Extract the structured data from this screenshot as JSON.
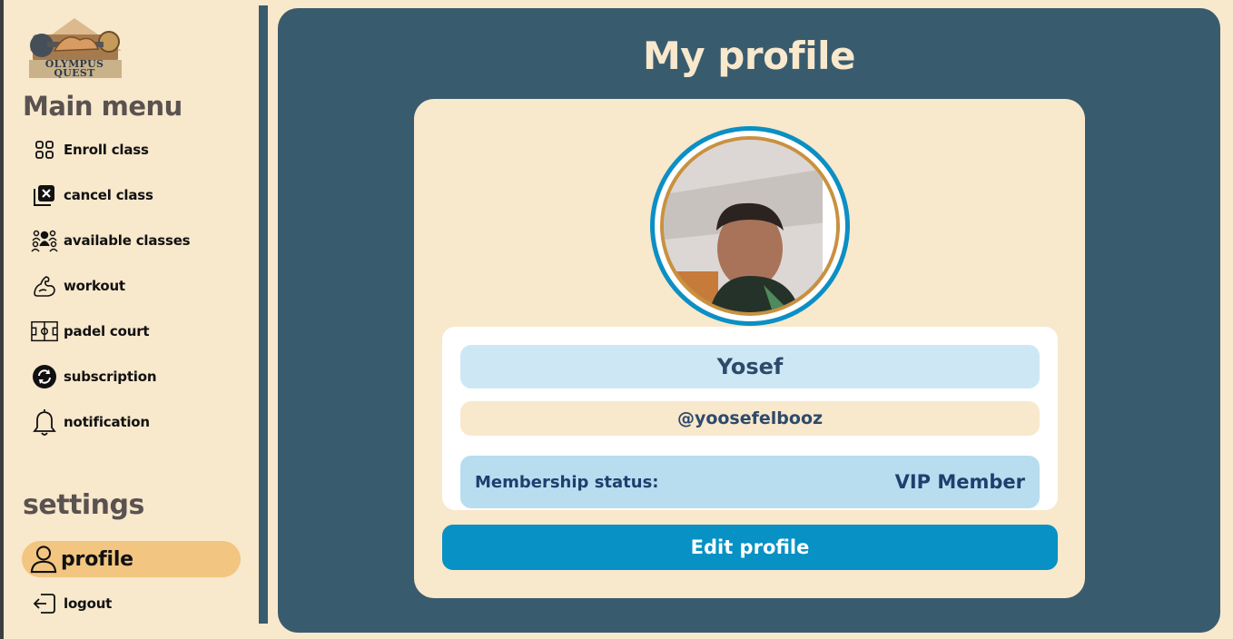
{
  "app": {
    "logo_text": "OLYMPUS QUEST"
  },
  "sidebar": {
    "main_menu_title": "Main menu",
    "items": [
      {
        "label": "Enroll class",
        "icon": "grid-icon"
      },
      {
        "label": "cancel class",
        "icon": "cancel-box-icon"
      },
      {
        "label": "available classes",
        "icon": "group-icon"
      },
      {
        "label": "workout",
        "icon": "muscle-icon"
      },
      {
        "label": "padel court",
        "icon": "court-icon"
      },
      {
        "label": "subscription",
        "icon": "refresh-icon"
      },
      {
        "label": "notification",
        "icon": "bell-icon"
      }
    ],
    "settings_title": "settings",
    "profile_label": "profile",
    "logout_label": "logout"
  },
  "main": {
    "title": "My profile",
    "name": "Yosef",
    "handle": "@yoosefelbooz",
    "membership_label": "Membership status:",
    "membership_value": "VIP Member",
    "edit_button": "Edit profile"
  },
  "colors": {
    "background": "#f8e8cc",
    "panel": "#395b6e",
    "accent": "#0891c4",
    "active_pill": "#f2c580"
  }
}
